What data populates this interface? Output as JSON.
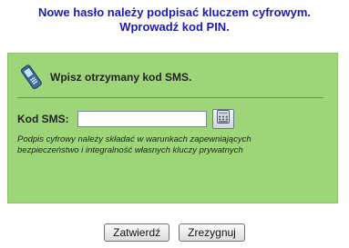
{
  "header": {
    "line1": "Nowe hasło należy podpisać kluczem cyfrowym.",
    "line2": "Wprowadź kod PIN."
  },
  "sms_panel": {
    "title": "Wpisz otrzymany kod SMS.",
    "icon": "mobile-phone-icon",
    "code_label": "Kod SMS:",
    "code_value": "",
    "keypad_icon": "virtual-keypad-icon",
    "note_line1": "Podpis cyfrowy należy składać  w warunkach zapewniających",
    "note_line2": "bezpieczeństwo i integralność własnych kluczy prywatnych"
  },
  "buttons": {
    "confirm_label": "Zatwierdź",
    "cancel_label": "Zrezygnuj"
  },
  "colors": {
    "header_text": "#1a1ab8",
    "panel_bg": "#9ed579",
    "divider": "#6a7faa"
  }
}
